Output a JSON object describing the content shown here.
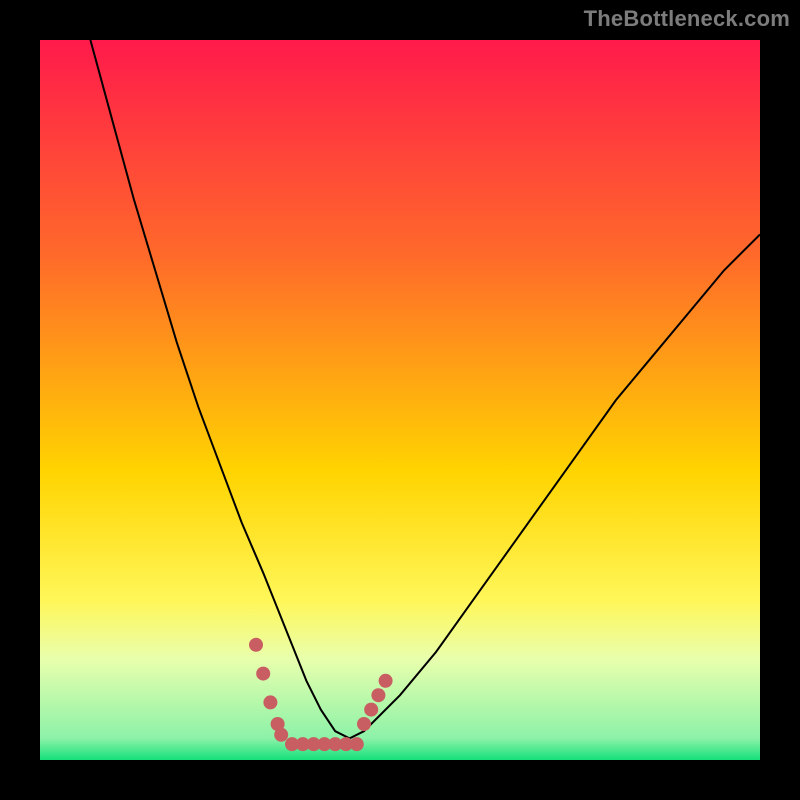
{
  "watermark": "TheBottleneck.com",
  "colors": {
    "background": "#000000",
    "gradient_top": "#ff1a4b",
    "gradient_mid1": "#ff6a2a",
    "gradient_mid2": "#ffd400",
    "gradient_mid3": "#fff75a",
    "gradient_band": "#e8ffad",
    "gradient_bottom": "#14e07a",
    "curve_stroke": "#000000",
    "marker": "#c95e62"
  },
  "chart_data": {
    "type": "line",
    "title": "",
    "xlabel": "",
    "ylabel": "",
    "xlim": [
      0,
      100
    ],
    "ylim": [
      0,
      100
    ],
    "grid": false,
    "legend": false,
    "series": [
      {
        "name": "curve",
        "x": [
          7,
          10,
          13,
          16,
          19,
          22,
          25,
          28,
          31,
          33,
          35,
          37,
          39,
          41,
          43,
          45,
          50,
          55,
          60,
          65,
          70,
          75,
          80,
          85,
          90,
          95,
          100
        ],
        "y": [
          100,
          89,
          78,
          68,
          58,
          49,
          41,
          33,
          26,
          21,
          16,
          11,
          7,
          4,
          3,
          4,
          9,
          15,
          22,
          29,
          36,
          43,
          50,
          56,
          62,
          68,
          73
        ]
      }
    ],
    "markers": {
      "left": {
        "x": [
          30,
          31,
          32,
          33,
          33.5
        ],
        "y": [
          16,
          12,
          8,
          5,
          3.5
        ]
      },
      "right": {
        "x": [
          45,
          46,
          47,
          48
        ],
        "y": [
          5,
          7,
          9,
          11
        ]
      },
      "bottom": {
        "x": [
          35,
          36.5,
          38,
          39.5,
          41,
          42.5,
          44
        ],
        "y": [
          2.2,
          2.2,
          2.2,
          2.2,
          2.2,
          2.2,
          2.2
        ]
      }
    },
    "gradient_stops": [
      {
        "offset": 0.0,
        "color": "#ff1a4b"
      },
      {
        "offset": 0.3,
        "color": "#ff6a2a"
      },
      {
        "offset": 0.6,
        "color": "#ffd400"
      },
      {
        "offset": 0.78,
        "color": "#fff75a"
      },
      {
        "offset": 0.86,
        "color": "#e8ffad"
      },
      {
        "offset": 0.97,
        "color": "#8cf2a8"
      },
      {
        "offset": 1.0,
        "color": "#14e07a"
      }
    ]
  }
}
